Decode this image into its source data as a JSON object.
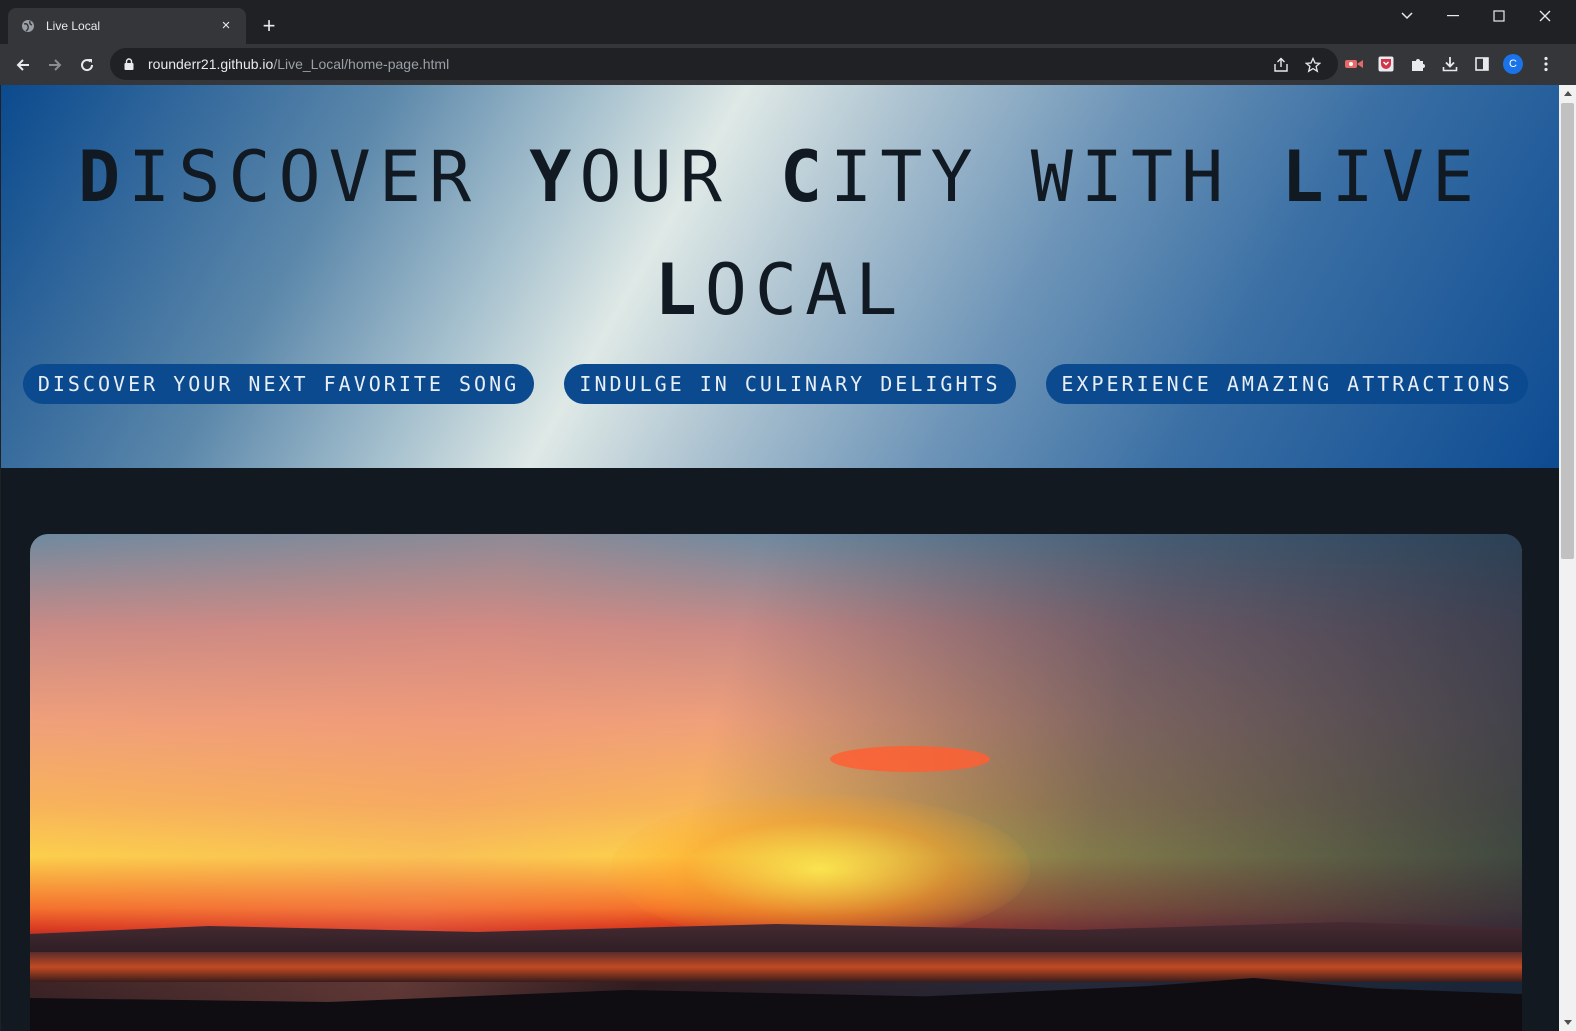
{
  "browser": {
    "tab_title": "Live Local",
    "tab_close": "×",
    "new_tab": "+",
    "url_host": "rounderr21.github.io",
    "url_path": "/Live_Local/home-page.html",
    "profile_initial": "C"
  },
  "hero": {
    "title_words": [
      {
        "first": "D",
        "rest": "iscover "
      },
      {
        "first": "Y",
        "rest": "our "
      },
      {
        "first": "C",
        "rest": "ity "
      },
      {
        "first": "",
        "rest": "with "
      },
      {
        "first": "L",
        "rest": "ive "
      },
      {
        "first": "L",
        "rest": "ocal"
      }
    ]
  },
  "nav_pills": [
    {
      "label": "Discover Your Next Favorite Song"
    },
    {
      "label": "Indulge in Culinary Delights"
    },
    {
      "label": "Experience Amazing Attractions"
    }
  ],
  "colors": {
    "accent": "#0b4a8e",
    "page_bg": "#121920",
    "heading": "#111a23"
  }
}
